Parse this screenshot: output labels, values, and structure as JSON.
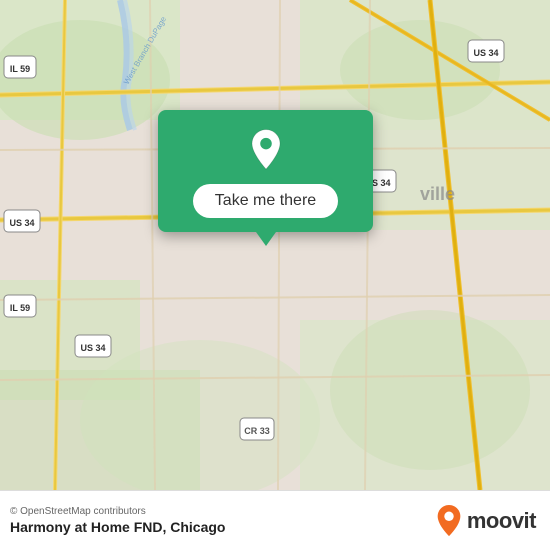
{
  "map": {
    "copyright": "© OpenStreetMap contributors",
    "background_color": "#e8e0d8"
  },
  "popup": {
    "button_label": "Take me there",
    "pin_color": "#ffffff",
    "bg_color": "#2eaa6e"
  },
  "bottom_bar": {
    "copyright": "© OpenStreetMap contributors",
    "location_name": "Harmony at Home FND, Chicago",
    "moovit_label": "moovit"
  },
  "icons": {
    "map_pin": "map-pin-icon",
    "moovit_pin": "moovit-pin-icon"
  }
}
